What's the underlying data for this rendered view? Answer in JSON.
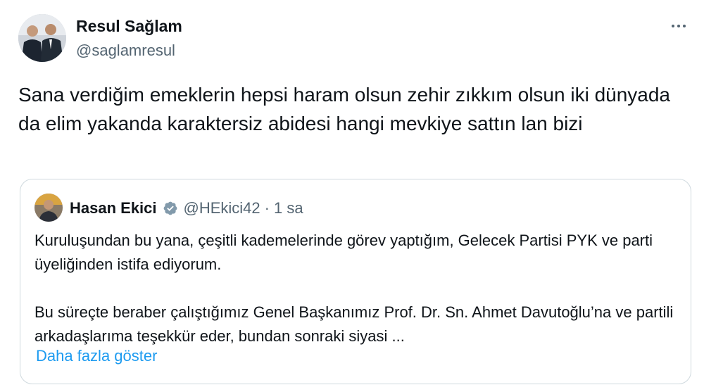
{
  "tweet": {
    "author": {
      "name": "Resul Sağlam",
      "handle": "@saglamresul"
    },
    "text": "Sana verdiğim emeklerin hepsi haram olsun zehir zıkkım olsun iki dünyada da elim yakanda karaktersiz abidesi hangi mevkiye sattın lan bizi",
    "more_icon": "more-horizontal-icon"
  },
  "quote": {
    "author": {
      "name": "Hasan Ekici",
      "handle": "@HEkici42",
      "verified_icon": "verified-badge-icon",
      "verified_color": "#8899a6"
    },
    "separator": "·",
    "time": "1 sa",
    "paragraphs": [
      "Kuruluşundan bu yana, çeşitli kademelerinde görev yaptığım, Gelecek Partisi PYK ve parti üyeliğinden istifa ediyorum.",
      "Bu süreçte beraber çalıştığımız Genel Başkanımız Prof. Dr. Sn. Ahmet Davutoğlu’na ve partili arkadaşlarıma teşekkür eder, bundan sonraki siyasi ..."
    ],
    "show_more": "Daha fazla göster"
  },
  "colors": {
    "text": "#0f1419",
    "secondary": "#536471",
    "link": "#1d9bf0",
    "border": "#cfd9de"
  }
}
